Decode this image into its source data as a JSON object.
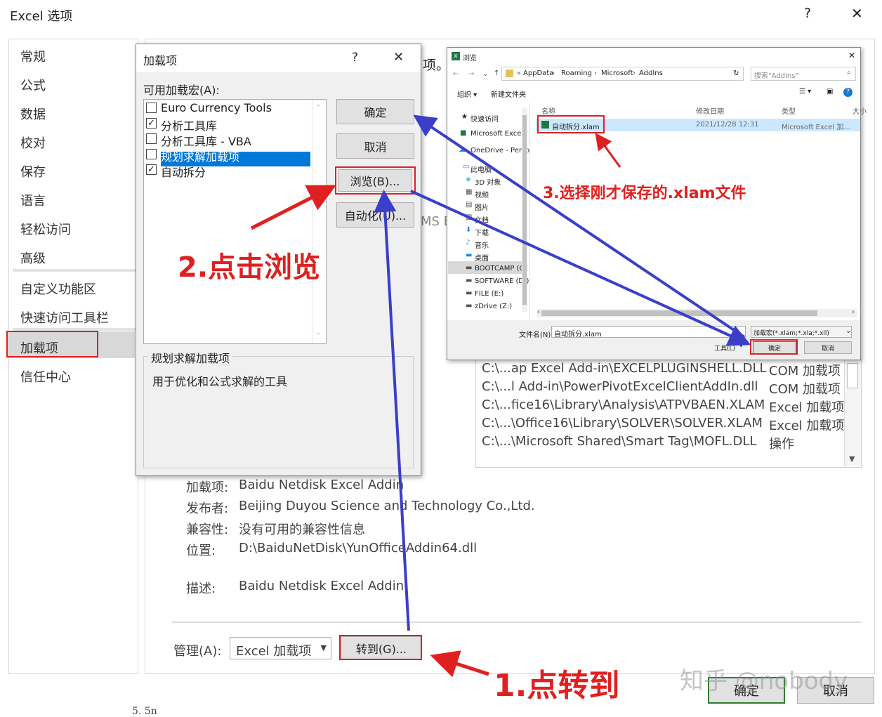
{
  "options": {
    "title": "Excel 选项",
    "help": "?",
    "close": "✕",
    "sidebar": [
      "常规",
      "公式",
      "数据",
      "校对",
      "保存",
      "语言",
      "轻松访问",
      "高级",
      "自定义功能区",
      "快速访问工具栏",
      "加载项",
      "信任中心"
    ],
    "top_fragment": "项。",
    "mid_fragment": "MS E",
    "addin_rows": [
      {
        "path": "C:\\...ap Excel Add-in\\EXCELPLUGINSHELL.DLL",
        "type": "COM 加载项"
      },
      {
        "path": "C:\\...l Add-in\\PowerPivotExcelClientAddIn.dll",
        "type": "COM 加载项"
      },
      {
        "path": "C:\\...fice16\\Library\\Analysis\\ATPVBAEN.XLAM",
        "type": "Excel 加载项"
      },
      {
        "path": "C:\\...\\Office16\\Library\\SOLVER\\SOLVER.XLAM",
        "type": "Excel 加载项"
      },
      {
        "path": "C:\\...\\Microsoft Shared\\Smart Tag\\MOFL.DLL",
        "type": "操作"
      }
    ],
    "details": [
      {
        "label": "加载项:",
        "value": "Baidu Netdisk Excel Addin"
      },
      {
        "label": "发布者:",
        "value": "Beijing Duyou Science and Technology Co.,Ltd."
      },
      {
        "label": "兼容性:",
        "value": "没有可用的兼容性信息"
      },
      {
        "label": "位置:",
        "value": "D:\\BaiduNetDisk\\YunOfficeAddin64.dll"
      },
      {
        "label": "描述:",
        "value": "Baidu Netdisk Excel Addin"
      }
    ],
    "manage_label": "管理(A):",
    "manage_value": "Excel 加载项",
    "goto_button": "转到(G)...",
    "ok": "确定",
    "cancel": "取消",
    "sheet_fragment": "5. 5n"
  },
  "addins": {
    "title": "加载项",
    "help": "?",
    "close": "✕",
    "list_label": "可用加载宏(A):",
    "items": [
      {
        "label": "Euro Currency Tools",
        "checked": false,
        "selected": false
      },
      {
        "label": "分析工具库",
        "checked": true,
        "selected": false
      },
      {
        "label": "分析工具库 - VBA",
        "checked": false,
        "selected": false
      },
      {
        "label": "规划求解加载项",
        "checked": false,
        "selected": true
      },
      {
        "label": "自动拆分",
        "checked": true,
        "selected": false
      }
    ],
    "ok": "确定",
    "cancel": "取消",
    "browse": "浏览(B)...",
    "automation": "自动化(U)...",
    "desc_title": "规划求解加载项",
    "desc_text": "用于优化和公式求解的工具"
  },
  "browse": {
    "title": "浏览",
    "breadcrumb": [
      "AppData",
      "Roaming",
      "Microsoft",
      "AddIns"
    ],
    "search_placeholder": "搜索\"AddIns\"",
    "organize": "组织 ▾",
    "new_folder": "新建文件夹",
    "nav": [
      "快速访问",
      "Microsoft Excel",
      "OneDrive - Perso",
      "此电脑",
      "3D 对象",
      "视频",
      "图片",
      "文档",
      "下载",
      "音乐",
      "桌面",
      "BOOTCAMP (C:",
      "SOFTWARE (D:)",
      "FILE (E:)",
      "zDrive (Z:)"
    ],
    "columns": [
      "名称",
      "修改日期",
      "类型",
      "大小"
    ],
    "file": {
      "name": "自动拆分.xlam",
      "date": "2021/12/28 12:31",
      "type": "Microsoft Excel 加..."
    },
    "filename_label": "文件名(N):",
    "filename_value": "自动拆分.xlam",
    "filter_value": "加载宏(*.xlam;*.xla;*.xll)",
    "tools": "工具(L)",
    "ok": "确定",
    "cancel": "取消"
  },
  "annotations": {
    "step1": "1.点转到",
    "step2": "2.点击浏览",
    "step3": "3.选择刚才保存的.xlam文件",
    "watermark": "知乎 @nobody"
  },
  "colors": {
    "annotation_red": "#e02020",
    "arrow_blue": "#3a3fc8",
    "selection_blue": "#0078d7",
    "ok_green": "#2e7d32"
  }
}
